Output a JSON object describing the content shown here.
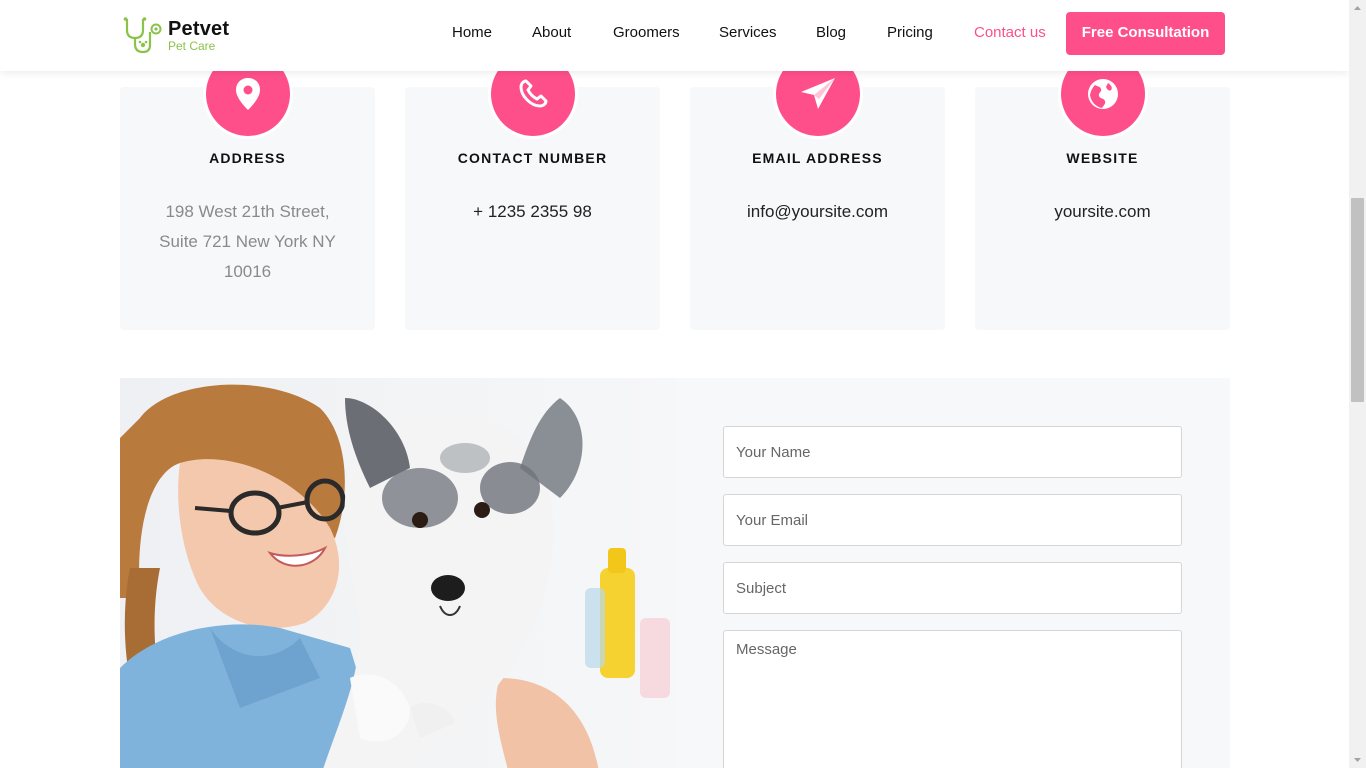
{
  "brand": {
    "name": "Petvet",
    "tagline": "Pet Care"
  },
  "nav": {
    "items": [
      {
        "label": "Home"
      },
      {
        "label": "About"
      },
      {
        "label": "Groomers"
      },
      {
        "label": "Services"
      },
      {
        "label": "Blog"
      },
      {
        "label": "Pricing"
      },
      {
        "label": "Contact us"
      }
    ],
    "active": "Contact us",
    "cta_label": "Free Consultation"
  },
  "contact_cards": [
    {
      "icon": "map-pin-icon",
      "title": "ADDRESS",
      "lines": [
        "198 West 21th Street,",
        "Suite 721 New York NY",
        "10016"
      ]
    },
    {
      "icon": "phone-icon",
      "title": "CONTACT NUMBER",
      "lines": [
        "+ 1235 2355 98"
      ]
    },
    {
      "icon": "paper-plane-icon",
      "title": "EMAIL ADDRESS",
      "lines": [
        "info@yoursite.com"
      ]
    },
    {
      "icon": "globe-icon",
      "title": "WEBSITE",
      "lines": [
        "yoursite.com"
      ]
    }
  ],
  "form": {
    "name_placeholder": "Your Name",
    "email_placeholder": "Your Email",
    "subject_placeholder": "Subject",
    "message_placeholder": "Message"
  },
  "colors": {
    "accent": "#ff4f8b",
    "brand_green": "#8bc34a",
    "card_bg": "#f7f8fa"
  }
}
